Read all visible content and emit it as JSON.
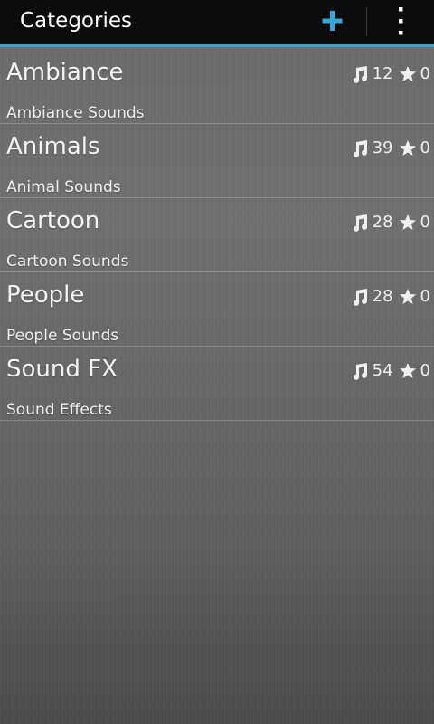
{
  "action_bar": {
    "title": "Categories",
    "add_icon": "plus-icon",
    "overflow_icon": "more-vertical-icon",
    "accent": "#33a6d8"
  },
  "categories": [
    {
      "title": "Ambiance",
      "subtitle": "Ambiance Sounds",
      "sounds": "12",
      "favorites": "0"
    },
    {
      "title": "Animals",
      "subtitle": "Animal Sounds",
      "sounds": "39",
      "favorites": "0"
    },
    {
      "title": "Cartoon",
      "subtitle": "Cartoon Sounds",
      "sounds": "28",
      "favorites": "0"
    },
    {
      "title": "People",
      "subtitle": "People Sounds",
      "sounds": "28",
      "favorites": "0"
    },
    {
      "title": "Sound FX",
      "subtitle": "Sound Effects",
      "sounds": "54",
      "favorites": "0"
    }
  ],
  "icons": {
    "sounds": "music-note-icon",
    "favorites": "star-icon"
  }
}
